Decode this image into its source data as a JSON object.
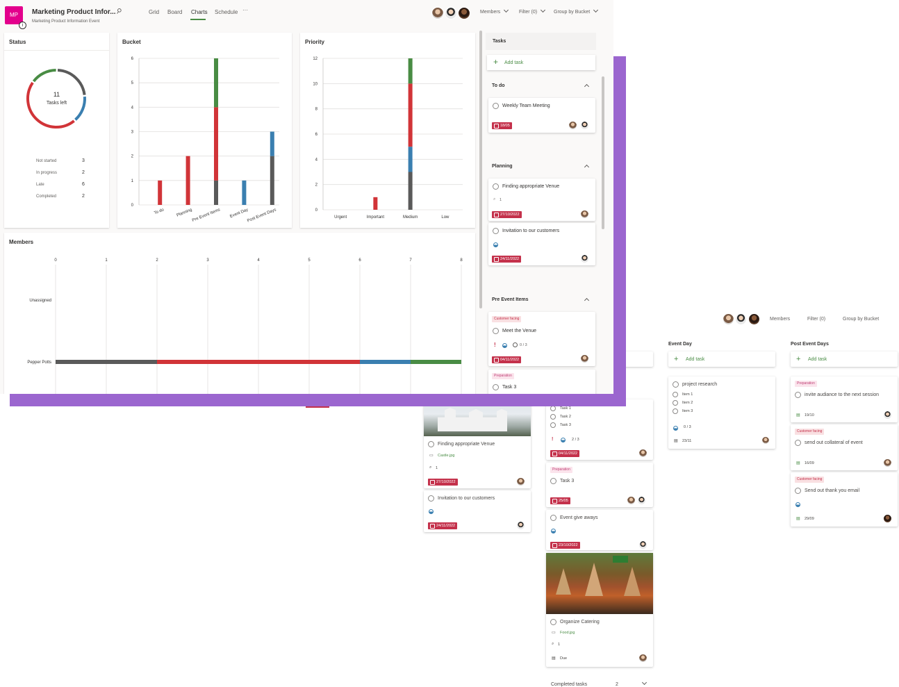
{
  "app": {
    "initials": "MP",
    "title": "Marketing Product Infor...",
    "subtitle": "Marketing Product Information Event",
    "accent": "#e3008c",
    "purple": "#9b66cf"
  },
  "nav": {
    "grid": "Grid",
    "board": "Board",
    "charts": "Charts",
    "schedule": "Schedule",
    "more": "···"
  },
  "header": {
    "members": "Members",
    "filter": "Filter (0)",
    "group_by": "Group by Bucket"
  },
  "status": {
    "title": "Status",
    "center_number": "11",
    "center_label": "Tasks left",
    "rows": [
      {
        "label": "Not started",
        "value": "3"
      },
      {
        "label": "In progress",
        "value": "2"
      },
      {
        "label": "Late",
        "value": "6"
      },
      {
        "label": "Completed",
        "value": "2"
      }
    ]
  },
  "colors": {
    "not_started": "#5a5a5a",
    "in_progress": "#3a7fb0",
    "late": "#d13438",
    "completed": "#498c44"
  },
  "chart_data": [
    {
      "type": "pie",
      "title": "Status",
      "categories": [
        "Not started",
        "In progress",
        "Late",
        "Completed"
      ],
      "values": [
        3,
        2,
        6,
        2
      ]
    },
    {
      "type": "bar",
      "title": "Bucket",
      "categories": [
        "To do",
        "Planning",
        "Pre Event Items",
        "Event Day",
        "Post Event Days"
      ],
      "series": [
        {
          "name": "Not started",
          "values": [
            0,
            0,
            1,
            0,
            2
          ]
        },
        {
          "name": "In progress",
          "values": [
            0,
            0,
            0,
            1,
            1
          ]
        },
        {
          "name": "Late",
          "values": [
            1,
            2,
            3,
            0,
            0
          ]
        },
        {
          "name": "Completed",
          "values": [
            0,
            0,
            2,
            0,
            0
          ]
        }
      ],
      "ylim": [
        0,
        6
      ],
      "yticks": [
        "0",
        "1",
        "2",
        "3",
        "4",
        "5",
        "6"
      ]
    },
    {
      "type": "bar",
      "title": "Priority",
      "categories": [
        "Urgent",
        "Important",
        "Medium",
        "Low"
      ],
      "series": [
        {
          "name": "Not started",
          "values": [
            0,
            0,
            3,
            0
          ]
        },
        {
          "name": "In progress",
          "values": [
            0,
            0,
            2,
            0
          ]
        },
        {
          "name": "Late",
          "values": [
            0,
            1,
            5,
            0
          ]
        },
        {
          "name": "Completed",
          "values": [
            0,
            0,
            2,
            0
          ]
        }
      ],
      "ylim": [
        0,
        12
      ],
      "yticks": [
        "0",
        "2",
        "4",
        "6",
        "8",
        "10",
        "12"
      ]
    },
    {
      "type": "bar",
      "title": "Members",
      "orientation": "horizontal",
      "categories": [
        "Unassigned",
        "Pepper Potts"
      ],
      "series": [
        {
          "name": "Not started",
          "values": [
            0,
            2
          ]
        },
        {
          "name": "Late",
          "values": [
            0,
            4
          ]
        },
        {
          "name": "In progress",
          "values": [
            0,
            1
          ]
        },
        {
          "name": "Completed",
          "values": [
            0,
            1
          ]
        }
      ],
      "xlim": [
        0,
        8
      ],
      "xticks": [
        "0",
        "1",
        "2",
        "3",
        "4",
        "5",
        "6",
        "7",
        "8"
      ]
    }
  ],
  "tasks_panel": {
    "title": "Tasks",
    "add_task": "Add task",
    "buckets": [
      {
        "name": "To do",
        "cards": [
          {
            "title": "Weekly Team Meeting",
            "date": "18/05"
          }
        ]
      },
      {
        "name": "Planning",
        "cards": [
          {
            "title": "Finding appropriate Venue",
            "attachments": "1",
            "date": "27/10/2022"
          },
          {
            "title": "Invitation to our customers",
            "date": "24/11/2022"
          }
        ]
      },
      {
        "name": "Pre Event Items",
        "cards": [
          {
            "label": "Customer facing",
            "title": "Meet the Venue",
            "checklist": "0 / 3",
            "date": "04/11/2022"
          },
          {
            "label": "Preparation",
            "title": "Task 3"
          }
        ]
      }
    ]
  },
  "board": {
    "header": {
      "members": "Members",
      "filter": "Filter (0)",
      "group_by": "Group by Bucket"
    },
    "planning_col": {
      "card1": {
        "title": "Finding appropriate Venue",
        "file": "Castle.jpg",
        "attachments": "1",
        "date": "27/10/2022"
      },
      "card2": {
        "title": "Invitation to our customers",
        "date": "24/11/2022"
      }
    },
    "pre_event_col": {
      "items": [
        "Task 1",
        "Task 2",
        "Task 3"
      ],
      "checklist": "2 / 3",
      "date1": "04/11/2022",
      "label2": "Preparation",
      "task3": "Task 3",
      "date2": "25/05",
      "giveaway": "Event give aways",
      "date3": "23/10/2022",
      "catering": "Organize Catering",
      "catering_file": "Food.jpg",
      "catering_attach": "1",
      "due": "Due",
      "completed": "Completed tasks",
      "completed_count": "2"
    },
    "event_day": {
      "title": "Event Day",
      "add_task": "Add task",
      "card_title": "project research",
      "items": [
        "Item 1",
        "Item 2",
        "Item 3"
      ],
      "checklist": "0 / 3",
      "date": "23/11"
    },
    "post_event": {
      "title": "Post Event Days",
      "add_task": "Add task",
      "cards": [
        {
          "label": "Preparation",
          "title": "invite audiance to the next session",
          "date": "19/10"
        },
        {
          "label": "Customer facing",
          "title": "send out collateral of event",
          "date": "16/09"
        },
        {
          "label": "Customer facing",
          "title": "Send out thank you email",
          "date": "29/09"
        }
      ]
    }
  }
}
